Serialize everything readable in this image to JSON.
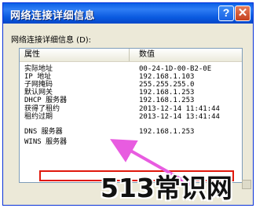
{
  "dialog": {
    "title": "网络连接详细信息",
    "help_label": "?",
    "close_label": "✕",
    "caption": "网络连接详细信息 (D):"
  },
  "list": {
    "columns": [
      "属性",
      "数值"
    ],
    "rows": [
      {
        "prop": "实际地址",
        "val": "00-24-1D-00-B2-0E"
      },
      {
        "prop": "IP 地址",
        "val": "192.168.1.103"
      },
      {
        "prop": "子网掩码",
        "val": "255.255.255.0"
      },
      {
        "prop": "默认网关",
        "val": "192.168.1.253"
      },
      {
        "prop": "DHCP 服务器",
        "val": "192.168.1.253"
      },
      {
        "prop": "获得了租约",
        "val": "2013-12-14 11:41:44"
      },
      {
        "prop": "租约过期",
        "val": "2013-12-14 13:41:44"
      },
      {
        "prop": "DNS 服务器",
        "val": "192.168.1.253"
      },
      {
        "prop": "WINS 服务器",
        "val": ""
      }
    ]
  },
  "overlay": {
    "highlight_color": "#e0180c",
    "arrow_color": "#e85ce0",
    "watermark": "513常识网"
  }
}
